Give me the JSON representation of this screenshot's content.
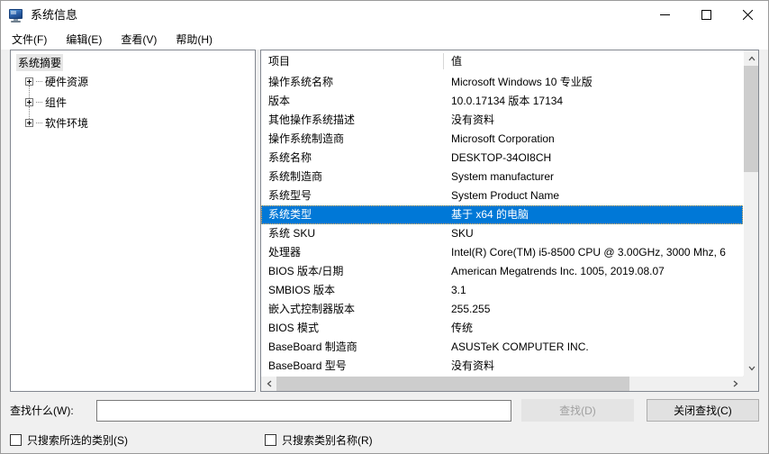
{
  "window": {
    "title": "系统信息",
    "app_icon": "computer-monitor-icon",
    "controls": {
      "minimize": "minimize-icon",
      "maximize": "maximize-icon",
      "close": "close-icon"
    }
  },
  "menubar": {
    "items": [
      {
        "label": "文件(F)"
      },
      {
        "label": "编辑(E)"
      },
      {
        "label": "查看(V)"
      },
      {
        "label": "帮助(H)"
      }
    ]
  },
  "tree": {
    "root": "系统摘要",
    "children": [
      {
        "label": "硬件资源"
      },
      {
        "label": "组件"
      },
      {
        "label": "软件环境"
      }
    ]
  },
  "list": {
    "columns": [
      "项目",
      "值"
    ],
    "selected_index": 7,
    "rows": [
      {
        "item": "操作系统名称",
        "value": "Microsoft Windows 10 专业版"
      },
      {
        "item": "版本",
        "value": "10.0.17134 版本 17134"
      },
      {
        "item": "其他操作系统描述",
        "value": "没有资料"
      },
      {
        "item": "操作系统制造商",
        "value": "Microsoft Corporation"
      },
      {
        "item": "系统名称",
        "value": "DESKTOP-34OI8CH"
      },
      {
        "item": "系统制造商",
        "value": "System manufacturer"
      },
      {
        "item": "系统型号",
        "value": "System Product Name"
      },
      {
        "item": "系统类型",
        "value": "基于 x64 的电脑"
      },
      {
        "item": "系统 SKU",
        "value": "SKU"
      },
      {
        "item": "处理器",
        "value": "Intel(R) Core(TM) i5-8500 CPU @ 3.00GHz, 3000 Mhz, 6"
      },
      {
        "item": "BIOS 版本/日期",
        "value": "American Megatrends Inc. 1005, 2019.08.07"
      },
      {
        "item": "SMBIOS 版本",
        "value": "3.1"
      },
      {
        "item": "嵌入式控制器版本",
        "value": "255.255"
      },
      {
        "item": "BIOS 模式",
        "value": "传统"
      },
      {
        "item": "BaseBoard 制造商",
        "value": "ASUSTeK COMPUTER INC."
      },
      {
        "item": "BaseBoard 型号",
        "value": "没有资料"
      }
    ]
  },
  "find": {
    "label": "查找什么(W):",
    "input_value": "",
    "input_placeholder": "",
    "find_button": "查找(D)",
    "close_button": "关闭查找(C)",
    "checkbox_selected_category": "只搜索所选的类别(S)",
    "checkbox_category_name_only": "只搜索类别名称(R)",
    "checkbox_selected_category_checked": false,
    "checkbox_category_name_only_checked": false,
    "find_button_enabled": false
  },
  "colors": {
    "selection_blue": "#0078d7",
    "focus_dotted": "#ffb44d",
    "window_bg": "#f0f0f0",
    "pane_border": "#828790",
    "scroll_thumb": "#cdcdcd"
  }
}
